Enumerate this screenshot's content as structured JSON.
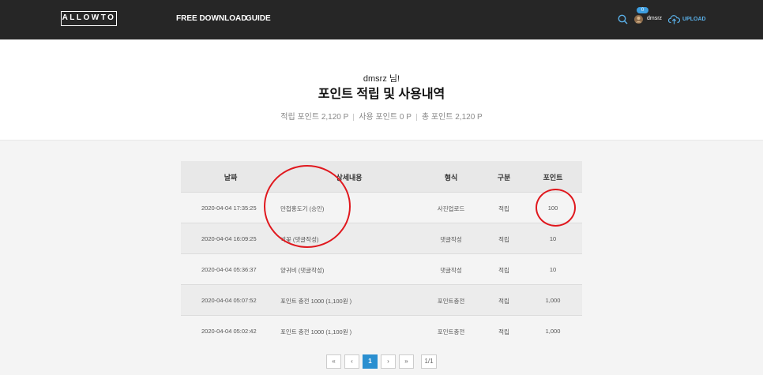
{
  "nav": {
    "logo": "ALLOWTO",
    "free_download": "FREE DOWNLOAD",
    "guide": "GUIDE",
    "badge": "0",
    "username": "dmsrz",
    "upload": "UPLOAD"
  },
  "header": {
    "greeting": "dmsrz 님!",
    "title": "포인트 적립 및 사용내역",
    "earned": "적립 포인트 2,120 P",
    "used": "사용 포인트 0 P",
    "total": "총 포인트 2,120 P"
  },
  "table": {
    "headers": [
      "날짜",
      "상세내용",
      "형식",
      "구분",
      "포인트"
    ],
    "rows": [
      {
        "date": "2020-04-04 17:35:25",
        "detail": "만첩홍도기 (승인)",
        "type": "사진업로드",
        "kind": "적립",
        "points": "100"
      },
      {
        "date": "2020-04-04 16:09:25",
        "detail": "박꽃 (댓글작성)",
        "type": "댓글작성",
        "kind": "적립",
        "points": "10"
      },
      {
        "date": "2020-04-04 05:36:37",
        "detail": "양귀비 (댓글작성)",
        "type": "댓글작성",
        "kind": "적립",
        "points": "10"
      },
      {
        "date": "2020-04-04 05:07:52",
        "detail": "포인트 충전 1000 (1,100원 )",
        "type": "포인트충전",
        "kind": "적립",
        "points": "1,000"
      },
      {
        "date": "2020-04-04 05:02:42",
        "detail": "포인트 충전 1000 (1,100원 )",
        "type": "포인트충전",
        "kind": "적립",
        "points": "1,000"
      }
    ]
  },
  "pagination": {
    "first": "«",
    "prev": "‹",
    "current": "1",
    "next": "›",
    "last": "»",
    "page_info": "1/1"
  },
  "colors": {
    "topbar": "#262626",
    "accent": "#2a8fd0",
    "annotation": "#e0181e"
  }
}
